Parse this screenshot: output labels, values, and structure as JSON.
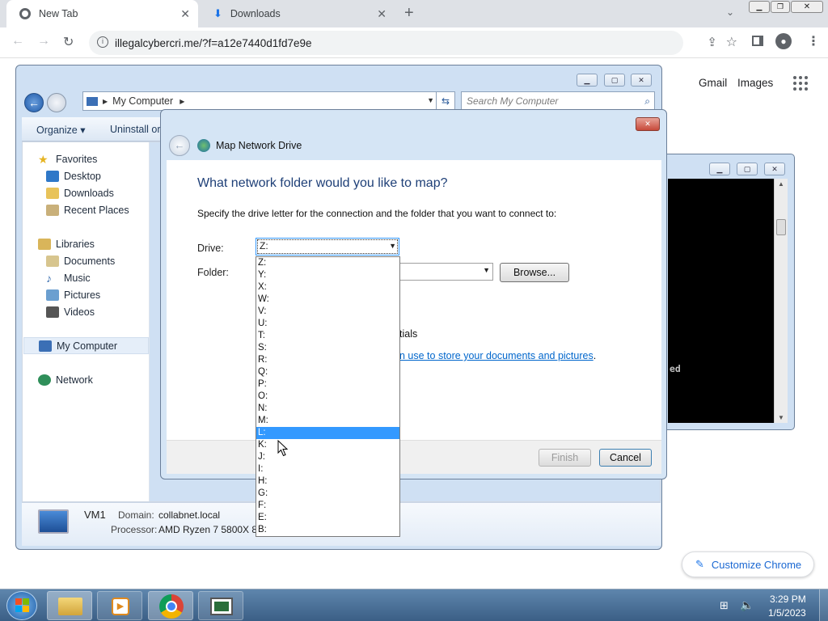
{
  "browser": {
    "tabs": [
      {
        "label": "New Tab",
        "active": true
      },
      {
        "label": "Downloads",
        "active": false
      }
    ],
    "address": "illegalcybercri.me/?f=a12e7440d1fd7e9e",
    "links": {
      "gmail": "Gmail",
      "images": "Images"
    },
    "customize_label": "Customize Chrome"
  },
  "explorer": {
    "breadcrumb": "My Computer",
    "search_placeholder": "Search My Computer",
    "toolbar": {
      "organize": "Organize",
      "uninstall": "Uninstall or"
    },
    "nav": {
      "favorites": "Favorites",
      "favorites_items": [
        "Desktop",
        "Downloads",
        "Recent Places"
      ],
      "libraries": "Libraries",
      "libraries_items": [
        "Documents",
        "Music",
        "Pictures",
        "Videos"
      ],
      "computer": "My Computer",
      "network": "Network"
    },
    "details": {
      "name": "VM1",
      "domain_label": "Domain:",
      "domain": "collabnet.local",
      "processor_label": "Processor:",
      "processor": "AMD Ryzen 7 5800X 8-("
    }
  },
  "dialog": {
    "title": "Map Network Drive",
    "heading": "What network folder would you like to map?",
    "instruction": "Specify the drive letter for the connection and the folder that you want to connect to:",
    "drive_label": "Drive:",
    "drive_value": "Z:",
    "folder_label": "Folder:",
    "browse_label": "Browse...",
    "partial_text_1": "tials",
    "partial_link": "n use to store your documents and pictures",
    "partial_link_end": ".",
    "finish_label": "Finish",
    "cancel_label": "Cancel",
    "drive_options": [
      "Z:",
      "Y:",
      "X:",
      "W:",
      "V:",
      "U:",
      "T:",
      "S:",
      "R:",
      "Q:",
      "P:",
      "O:",
      "N:",
      "M:",
      "L:",
      "K:",
      "J:",
      "I:",
      "H:",
      "G:",
      "F:",
      "E:",
      "B:"
    ],
    "selected_option": "L:"
  },
  "console": {
    "visible_text": "ed"
  },
  "taskbar": {
    "time": "3:29 PM",
    "date": "1/5/2023"
  },
  "colors": {
    "selection": "#3399ff",
    "link": "#0066cc",
    "heading": "#1e3f77"
  }
}
